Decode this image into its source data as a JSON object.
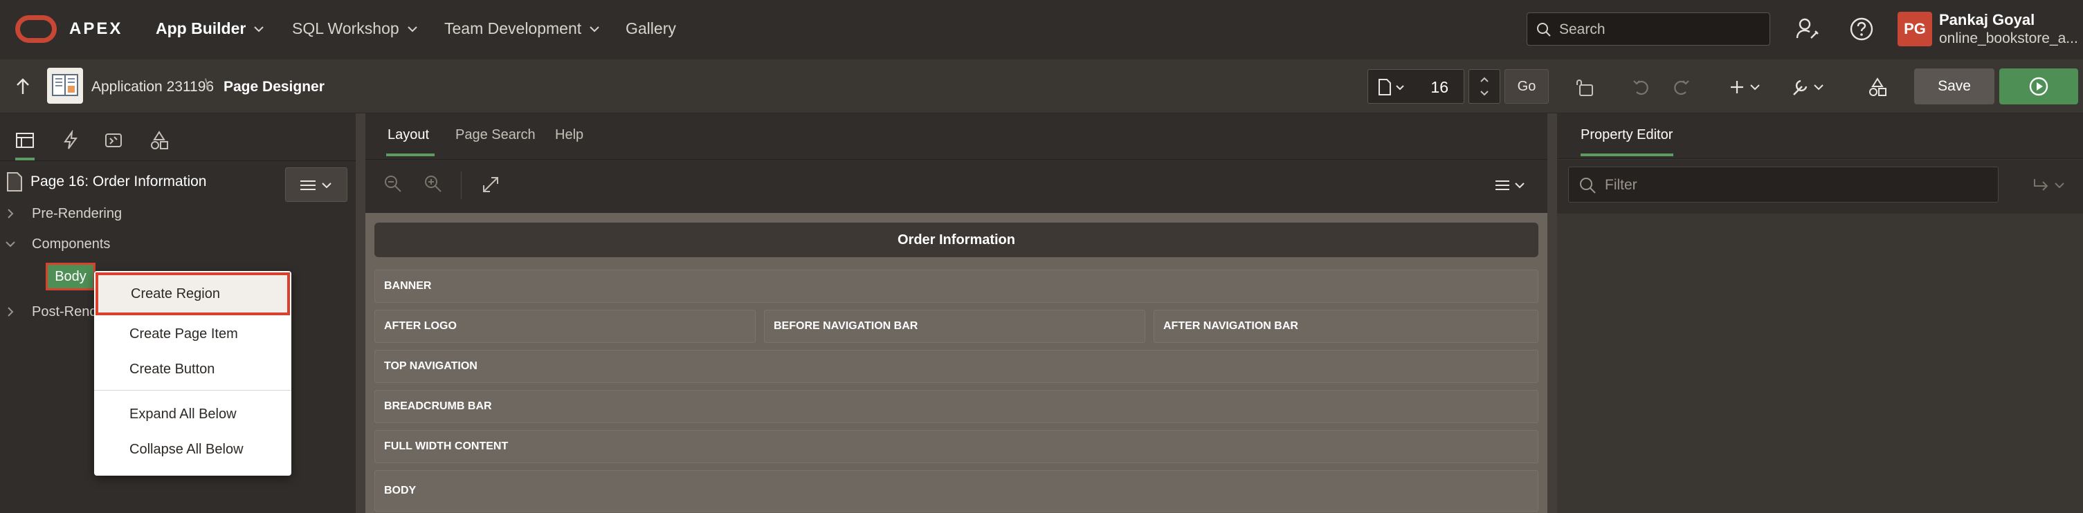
{
  "topnav": {
    "brand": "APEX",
    "items": [
      {
        "label": "App Builder"
      },
      {
        "label": "SQL Workshop"
      },
      {
        "label": "Team Development"
      },
      {
        "label": "Gallery"
      }
    ],
    "search_placeholder": "Search",
    "user": {
      "initials": "PG",
      "name": "Pankaj Goyal",
      "workspace": "online_bookstore_a..."
    }
  },
  "toolbar": {
    "app_name": "Application 231196",
    "separator": "\\",
    "page_designer": "Page Designer",
    "page_number": "16",
    "go_label": "Go",
    "save_label": "Save"
  },
  "left_panel": {
    "page_title": "Page 16: Order Information",
    "tree": {
      "pre_rendering": "Pre-Rendering",
      "components": "Components",
      "body": "Body",
      "post_rendering": "Post-Rend"
    }
  },
  "context_menu": {
    "items": [
      {
        "label": "Create Region"
      },
      {
        "label": "Create Page Item"
      },
      {
        "label": "Create Button"
      },
      {
        "label": "Expand All Below"
      },
      {
        "label": "Collapse All Below"
      }
    ]
  },
  "center": {
    "tabs": [
      {
        "label": "Layout"
      },
      {
        "label": "Page Search"
      },
      {
        "label": "Help"
      }
    ],
    "page_header": "Order Information",
    "slots": {
      "banner": "BANNER",
      "after_logo": "AFTER LOGO",
      "before_nav": "BEFORE NAVIGATION BAR",
      "after_nav": "AFTER NAVIGATION BAR",
      "top_nav": "TOP NAVIGATION",
      "breadcrumb": "BREADCRUMB BAR",
      "full_width": "FULL WIDTH CONTENT",
      "body": "BODY"
    }
  },
  "right_panel": {
    "tab": "Property Editor",
    "filter_placeholder": "Filter"
  },
  "colors": {
    "accent_green": "#4e8f55",
    "highlight_red": "#d9412d",
    "oracle_red": "#c74634"
  }
}
